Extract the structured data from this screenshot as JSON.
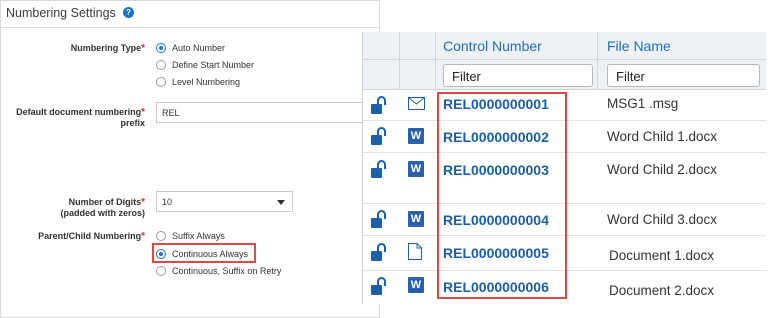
{
  "numbering_settings": {
    "title": "Numbering Settings",
    "help_icon": "?",
    "numbering_type": {
      "label": "Numbering Type",
      "options": [
        "Auto Number",
        "Define Start Number",
        "Level Numbering"
      ],
      "selected": "Auto Number"
    },
    "prefix": {
      "label_line1": "Default document numbering",
      "label_line2": "prefix",
      "value": "REL"
    },
    "digits": {
      "label_line1": "Number of Digits",
      "label_line2": "(padded with zeros)",
      "value": "10"
    },
    "parent_child": {
      "label": "Parent/Child Numbering",
      "options": [
        "Suffix Always",
        "Continuous Always",
        "Continuous, Suffix on Retry"
      ],
      "selected": "Continuous Always"
    },
    "required_marker": "*"
  },
  "document_grid": {
    "columns": [
      "Control Number",
      "File Name"
    ],
    "filter_placeholder": "Filter",
    "rows": [
      {
        "icon": "envelope-icon",
        "control_number": "REL0000000001",
        "file_name": "MSG1 .msg"
      },
      {
        "icon": "word-icon",
        "control_number": "REL0000000002",
        "file_name": "Word Child 1.docx"
      },
      {
        "icon": "word-icon",
        "control_number": "REL0000000003",
        "file_name": "Word Child 2.docx"
      },
      {
        "icon": "word-icon",
        "control_number": "REL0000000004",
        "file_name": "Word Child 3.docx"
      },
      {
        "icon": "document-icon",
        "control_number": "REL0000000005",
        "file_name": "Document 1.docx"
      },
      {
        "icon": "word-icon",
        "control_number": "REL0000000006",
        "file_name": "Document 2.docx"
      }
    ],
    "word_glyph": "W"
  },
  "colors": {
    "accent_blue": "#1a73c9",
    "control_number_blue": "#1a5ea8",
    "highlight_red": "#e04848",
    "header_bg": "#eef1f5"
  }
}
